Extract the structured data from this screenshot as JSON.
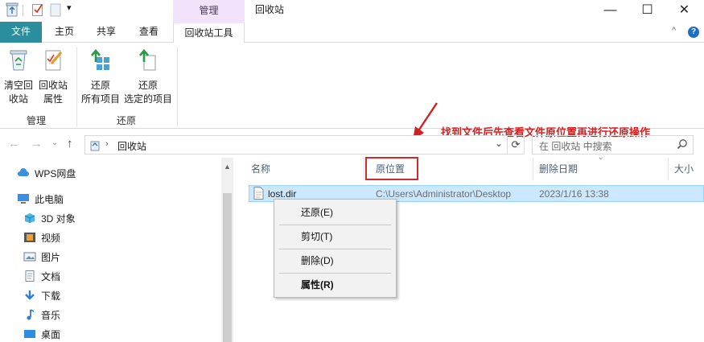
{
  "window": {
    "contextual_tab_header": "管理",
    "title": "回收站",
    "minimize": "—",
    "maximize": "☐",
    "close": "✕"
  },
  "tabs": {
    "file": "文件",
    "home": "主页",
    "share": "共享",
    "view": "查看",
    "recycle_tools": "回收站工具",
    "collapse": "^",
    "help": "?"
  },
  "ribbon": {
    "manage_group": {
      "label": "管理",
      "empty_line1": "清空回",
      "empty_line2": "收站",
      "props_line1": "回收站",
      "props_line2": "属性"
    },
    "restore_group": {
      "label": "还原",
      "restore_all_line1": "还原",
      "restore_all_line2": "所有项目",
      "restore_sel_line1": "还原",
      "restore_sel_line2": "选定的项目"
    }
  },
  "address": {
    "location": "回收站",
    "search_placeholder": "在 回收站 中搜索"
  },
  "nav_pane": {
    "items": [
      {
        "label": "WPS网盘"
      },
      {
        "label": "此电脑"
      },
      {
        "label": "3D 对象"
      },
      {
        "label": "视频"
      },
      {
        "label": "图片"
      },
      {
        "label": "文档"
      },
      {
        "label": "下载"
      },
      {
        "label": "音乐"
      },
      {
        "label": "桌面"
      }
    ]
  },
  "columns": {
    "name": "名称",
    "original_location": "原位置",
    "date_deleted": "删除日期",
    "size": "大小"
  },
  "file_row": {
    "name": "lost.dir",
    "original_location": "C:\\Users\\Administrator\\Desktop",
    "date_deleted": "2023/1/16 13:38"
  },
  "context_menu": {
    "restore": "还原(E)",
    "cut": "剪切(T)",
    "delete": "删除(D)",
    "properties": "属性(R)"
  },
  "annotation": {
    "text": "找到文件后先查看文件原位置再进行还原操作",
    "color": "#d42020"
  }
}
